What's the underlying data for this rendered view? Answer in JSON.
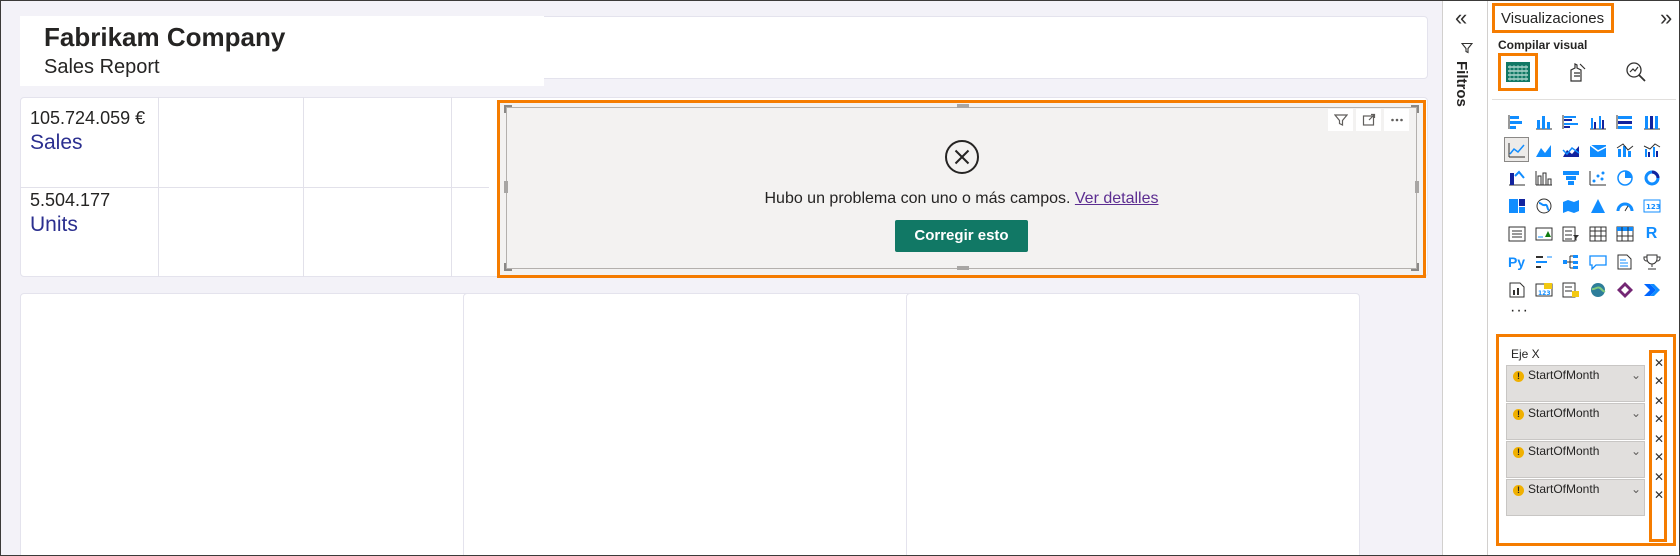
{
  "report": {
    "company": "Fabrikam Company",
    "subtitle": "Sales Report",
    "kpis": [
      {
        "value": "105.724.059 €",
        "label": "Sales"
      },
      {
        "value": "5.504.177",
        "label": "Units"
      }
    ]
  },
  "error_visual": {
    "message": "Hubo un problema con uno o más campos.",
    "link": "Ver detalles",
    "fix_button": "Corregir esto",
    "actions": [
      "filter-icon",
      "focus-mode-icon",
      "more-options-icon"
    ]
  },
  "filters_pane": {
    "label": "Filtros",
    "collapse_icon": "«"
  },
  "visualizations_pane": {
    "title": "Visualizaciones",
    "expand_icon": "»",
    "build_label": "Compilar visual",
    "tabs": [
      "build-visual-icon",
      "format-visual-icon",
      "analytics-icon"
    ],
    "more": "···",
    "field_well": {
      "label": "Eje X",
      "fields": [
        "StartOfMonth",
        "StartOfMonth",
        "StartOfMonth",
        "StartOfMonth"
      ]
    },
    "colors": {
      "accent_highlight": "#f57c00",
      "fix_button": "#117865",
      "label_blue": "#2b2f8f"
    }
  }
}
